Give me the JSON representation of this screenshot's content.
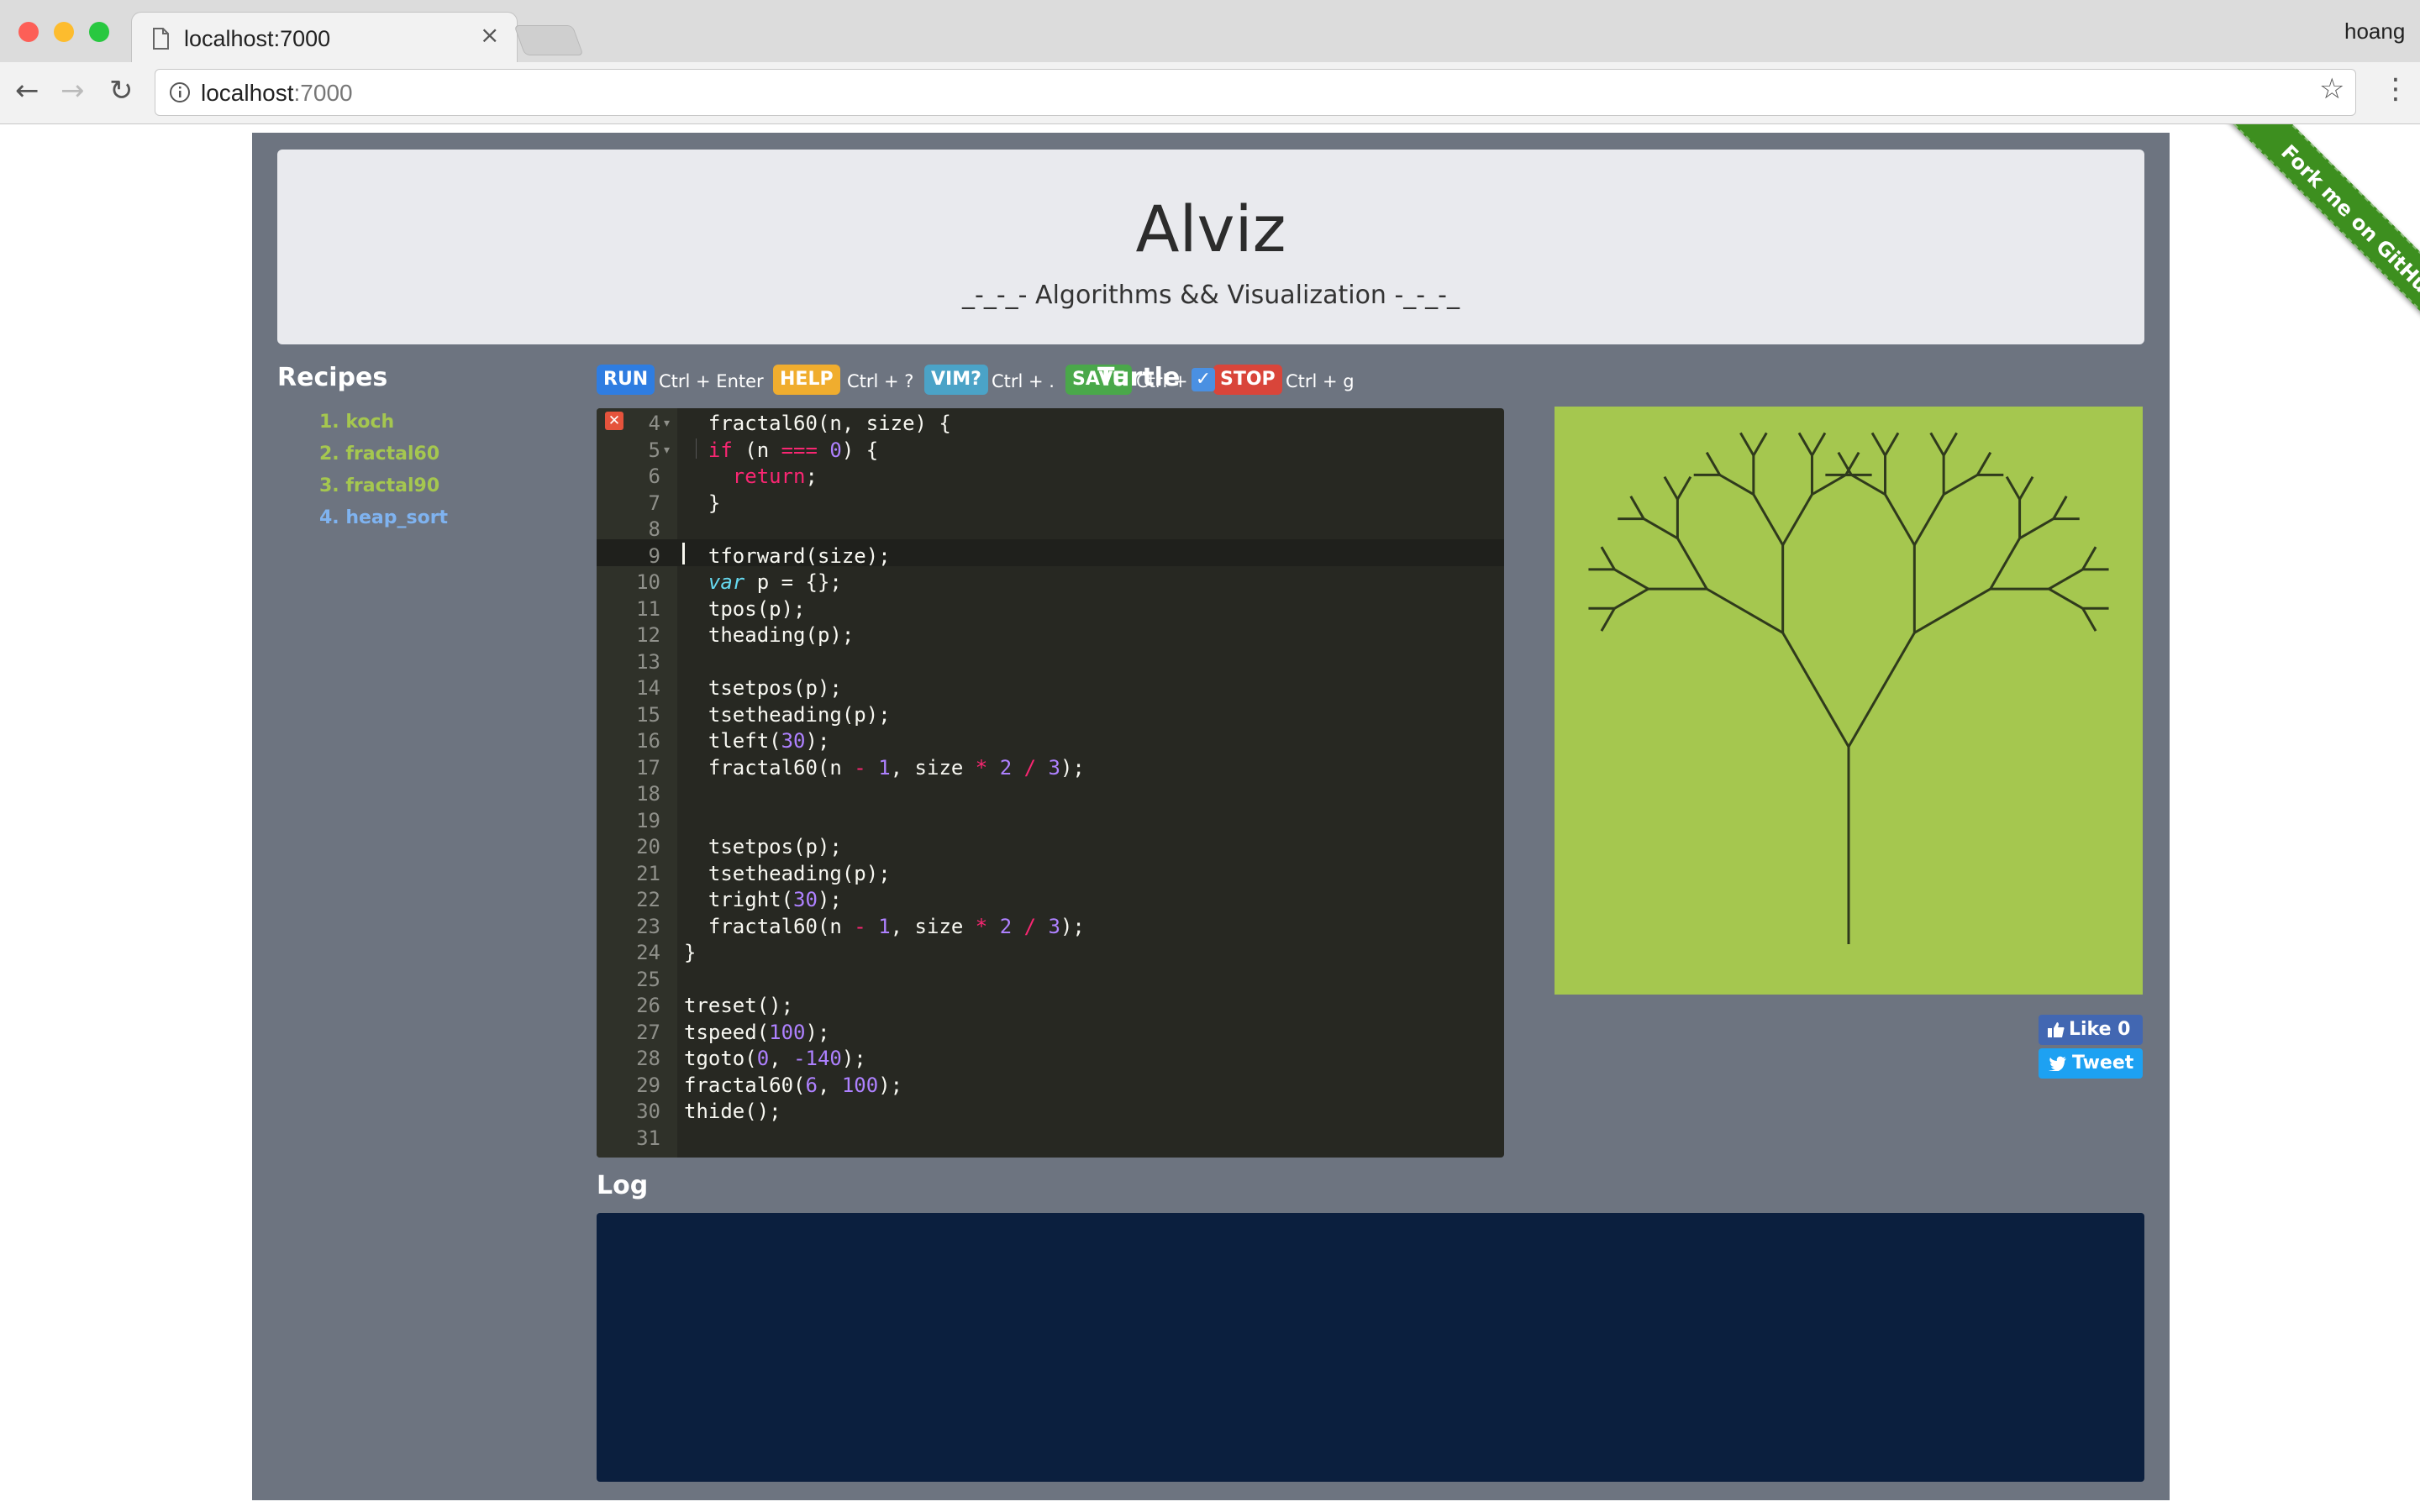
{
  "browser": {
    "tab_title": "localhost:7000",
    "tab_close": "×",
    "profile_name": "hoang",
    "url_host": "localhost",
    "url_port": ":7000",
    "back": "←",
    "forward": "→",
    "reload": "↻",
    "bookmark": "☆",
    "menu": "⋮"
  },
  "header": {
    "title": "Alviz",
    "subtitle": "_-_-_- Algorithms && Visualization -_-_-_"
  },
  "recipes": {
    "title": "Recipes",
    "items": [
      {
        "label": "1. koch",
        "color": "#a5c74f"
      },
      {
        "label": "2. fractal60",
        "color": "#a5c74f"
      },
      {
        "label": "3. fractal90",
        "color": "#a5c74f"
      },
      {
        "label": "4. heap_sort",
        "color": "#7fb3f0"
      }
    ]
  },
  "commands": [
    {
      "label": "RUN",
      "shortcut": "Ctrl + Enter",
      "color": "#2f7de1"
    },
    {
      "label": "HELP",
      "shortcut": "Ctrl + ?",
      "color": "#f0ad2e"
    },
    {
      "label": "VIM?",
      "shortcut": "Ctrl + .",
      "color": "#4ba3c7"
    },
    {
      "label": "SAVE",
      "shortcut": "Ctrl + s",
      "color": "#4aa84a"
    },
    {
      "label": "STOP",
      "shortcut": "Ctrl + g",
      "color": "#d9453a"
    }
  ],
  "editor": {
    "error_icon": "✕",
    "lines": [
      {
        "n": "4",
        "code": "  fractal60(n, size) {"
      },
      {
        "n": "5",
        "code": "  if (n === 0) {"
      },
      {
        "n": "6",
        "code": "    return;"
      },
      {
        "n": "7",
        "code": "  }"
      },
      {
        "n": "8",
        "code": ""
      },
      {
        "n": "9",
        "code": "  tforward(size);"
      },
      {
        "n": "10",
        "code": "  var p = {};"
      },
      {
        "n": "11",
        "code": "  tpos(p);"
      },
      {
        "n": "12",
        "code": "  theading(p);"
      },
      {
        "n": "13",
        "code": ""
      },
      {
        "n": "14",
        "code": "  tsetpos(p);"
      },
      {
        "n": "15",
        "code": "  tsetheading(p);"
      },
      {
        "n": "16",
        "code": "  tleft(30);"
      },
      {
        "n": "17",
        "code": "  fractal60(n - 1, size * 2 / 3);"
      },
      {
        "n": "18",
        "code": ""
      },
      {
        "n": "19",
        "code": ""
      },
      {
        "n": "20",
        "code": "  tsetpos(p);"
      },
      {
        "n": "21",
        "code": "  tsetheading(p);"
      },
      {
        "n": "22",
        "code": "  tright(30);"
      },
      {
        "n": "23",
        "code": "  fractal60(n - 1, size * 2 / 3);"
      },
      {
        "n": "24",
        "code": "}"
      },
      {
        "n": "25",
        "code": ""
      },
      {
        "n": "26",
        "code": "treset();"
      },
      {
        "n": "27",
        "code": "tspeed(100);"
      },
      {
        "n": "28",
        "code": "tgoto(0, -140);"
      },
      {
        "n": "29",
        "code": "fractal60(6, 100);"
      },
      {
        "n": "30",
        "code": "thide();"
      },
      {
        "n": "31",
        "code": ""
      }
    ]
  },
  "turtle": {
    "title": "Turtle",
    "checked": "✓",
    "canvas_color": "#a5c74f",
    "fractal_depth": 6,
    "fractal_size": 100,
    "angle": 30
  },
  "social": {
    "like_label": "Like 0",
    "tweet_label": "Tweet"
  },
  "log": {
    "title": "Log"
  },
  "ribbon": {
    "label": "Fork me on GitHub"
  }
}
